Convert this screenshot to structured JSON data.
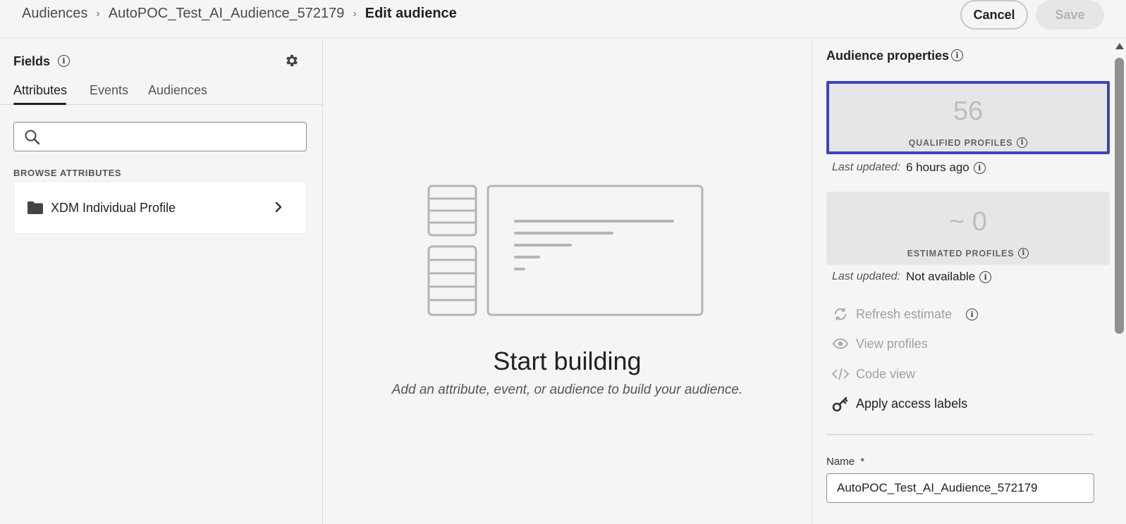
{
  "breadcrumb": {
    "items": [
      "Audiences",
      "AutoPOC_Test_AI_Audience_572179"
    ],
    "current": "Edit audience",
    "separator": "›"
  },
  "header": {
    "cancel_label": "Cancel",
    "save_label": "Save"
  },
  "fields_panel": {
    "title": "Fields",
    "tabs": [
      "Attributes",
      "Events",
      "Audiences"
    ],
    "active_tab": "Attributes",
    "search_placeholder": "",
    "browse_label": "BROWSE ATTRIBUTES",
    "browse_items": [
      {
        "label": "XDM Individual Profile",
        "icon": "folder-icon"
      }
    ]
  },
  "canvas": {
    "title": "Start building",
    "subtitle": "Add an attribute, event, or audience to build your audience."
  },
  "properties": {
    "title": "Audience properties",
    "qualified": {
      "value": "56",
      "label": "QUALIFIED PROFILES"
    },
    "qualified_updated": {
      "key": "Last updated:",
      "value": "6 hours ago"
    },
    "estimated": {
      "value": "~ 0",
      "label": "ESTIMATED PROFILES"
    },
    "estimated_updated": {
      "key": "Last updated:",
      "value": "Not available"
    },
    "actions": [
      {
        "label": "Refresh estimate",
        "icon": "refresh-icon",
        "enabled": false
      },
      {
        "label": "View profiles",
        "icon": "eye-icon",
        "enabled": false
      },
      {
        "label": "Code view",
        "icon": "code-icon",
        "enabled": false
      },
      {
        "label": "Apply access labels",
        "icon": "key-icon",
        "enabled": true
      }
    ],
    "name_label": "Name",
    "name_required": "*",
    "name_value": "AutoPOC_Test_AI_Audience_572179"
  },
  "colors": {
    "accent_selection": "#3d45b7",
    "background": "#f5f5f5",
    "card_background": "#e6e6e6"
  }
}
